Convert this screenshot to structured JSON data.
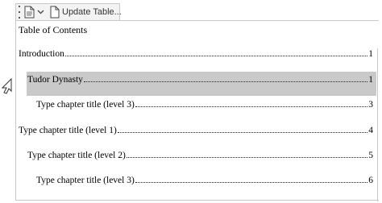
{
  "toolbar": {
    "grip_icon": "grip-dots-icon",
    "doc_icon": "document-icon",
    "dropdown_icon": "chevron-down-icon",
    "update_icon": "page-icon",
    "update_label": "Update Table..."
  },
  "toc": {
    "title": "Table of Contents",
    "entries": [
      {
        "text": "Introduction",
        "page": "1",
        "level": 1
      },
      {
        "text": "Tudor Dynasty",
        "page": "1",
        "level": 2,
        "selected": true
      },
      {
        "text": "Type chapter title (level 3)",
        "page": "3",
        "level": 3
      },
      {
        "text": "Type chapter title (level 1)",
        "page": "4",
        "level": 1
      },
      {
        "text": "Type chapter title (level 2)",
        "page": "5",
        "level": 2
      },
      {
        "text": "Type chapter title (level 3)",
        "page": "6",
        "level": 3
      }
    ]
  },
  "colors": {
    "selection": "#c9c9c9",
    "border": "#c8c8c8"
  }
}
